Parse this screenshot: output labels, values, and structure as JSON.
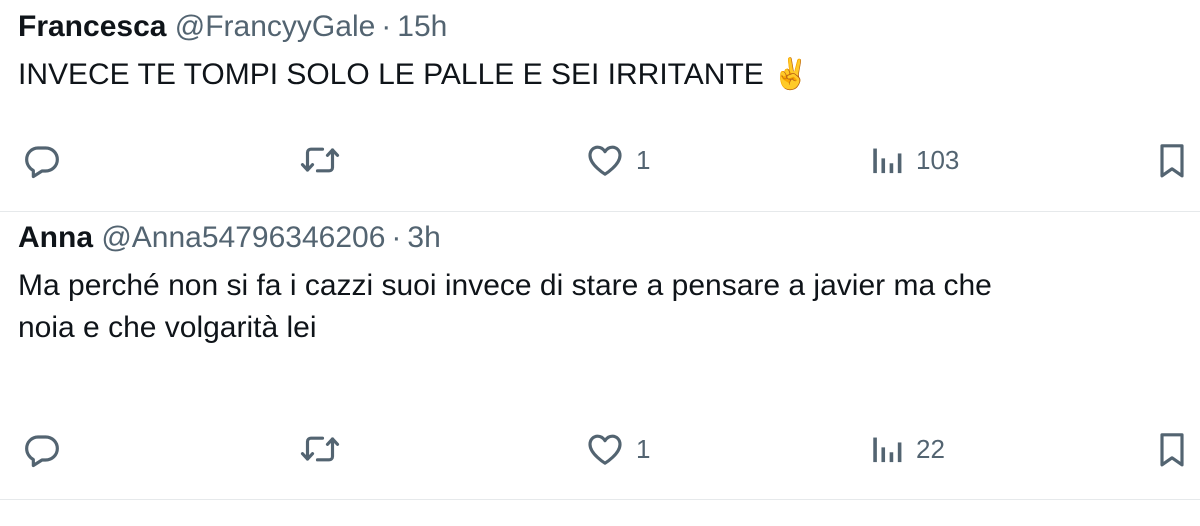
{
  "tweets": [
    {
      "name": "Francesca",
      "handle": "@FrancyyGale",
      "separator": "·",
      "time": "15h",
      "text": "INVECE TE TOMPI SOLO LE PALLE E SEI IRRITANTE",
      "emoji": "✌️",
      "likes": "1",
      "views": "103",
      "icons": {
        "reply": "reply-icon",
        "retweet": "retweet-icon",
        "like": "heart-icon",
        "views": "views-icon",
        "bookmark": "bookmark-icon"
      }
    },
    {
      "name": "Anna",
      "handle": "@Anna54796346206",
      "separator": "·",
      "time": "3h",
      "text": "Ma perché non si fa i cazzi suoi invece di stare a pensare a javier ma che\nnoia e che volgarità lei",
      "likes": "1",
      "views": "22",
      "icons": {
        "reply": "reply-icon",
        "retweet": "retweet-icon",
        "like": "heart-icon",
        "views": "views-icon",
        "bookmark": "bookmark-icon"
      }
    }
  ],
  "colors": {
    "text": "#0f1419",
    "secondary": "#536471",
    "divider": "#e6e9eb",
    "background": "#ffffff"
  }
}
